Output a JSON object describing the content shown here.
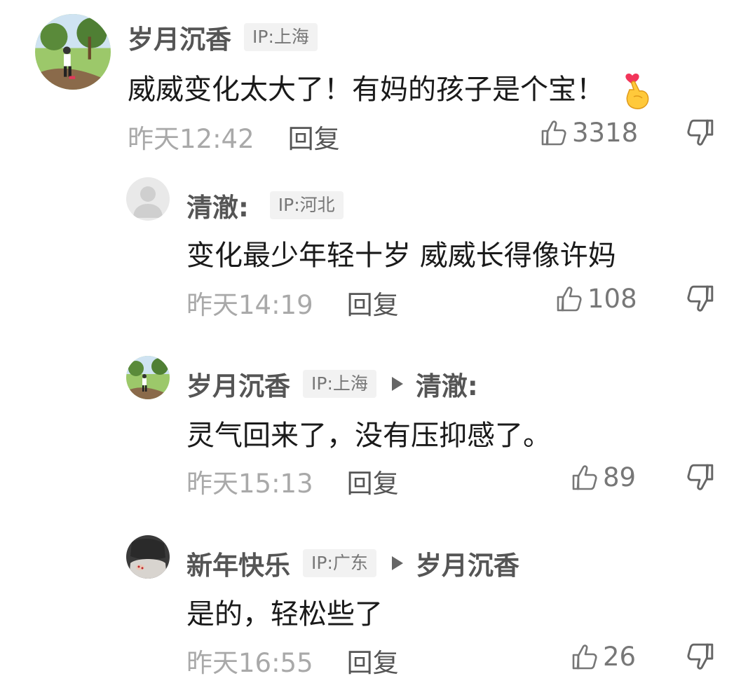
{
  "comments": [
    {
      "username": "岁月沉香",
      "ip": "IP:上海",
      "text": "威威变化太大了！有妈的孩子是个宝！",
      "emoji": "finger-heart",
      "time": "昨天12:42",
      "reply": "回复",
      "likes": "3318"
    },
    {
      "username": "清澈:",
      "ip": "IP:河北",
      "text": "变化最少年轻十岁  威威长得像许妈",
      "time": "昨天14:19",
      "reply": "回复",
      "likes": "108"
    },
    {
      "username": "岁月沉香",
      "ip": "IP:上海",
      "reply_to": "清澈:",
      "text": "灵气回来了，没有压抑感了。",
      "time": "昨天15:13",
      "reply": "回复",
      "likes": "89"
    },
    {
      "username": "新年快乐",
      "ip": "IP:广东",
      "reply_to": "岁月沉香",
      "text": "是的，轻松些了",
      "time": "昨天16:55",
      "reply": "回复",
      "likes": "26"
    }
  ],
  "icons": {
    "like": "thumbs-up-icon",
    "dislike": "thumbs-down-icon",
    "reply_arrow": "triangle-right-icon"
  },
  "colors": {
    "username": "#555555",
    "meta": "#a9a9a9",
    "ip_badge_bg": "#f2f2f2",
    "text": "#1a1a1a"
  }
}
